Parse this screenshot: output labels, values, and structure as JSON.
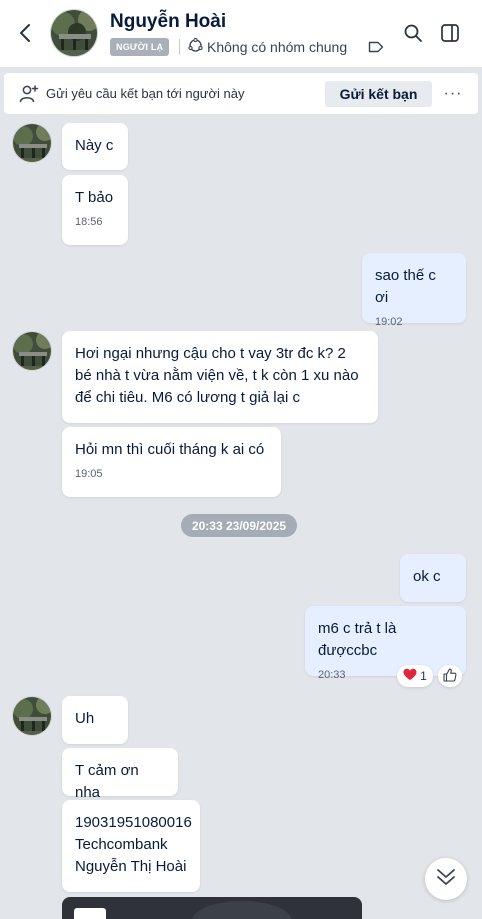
{
  "header": {
    "contact_name": "Nguyễn Hoài",
    "stranger_badge": "NGƯỜI LẠ",
    "common_groups": "Không có nhóm chung"
  },
  "friend_request": {
    "text": "Gửi yêu cầu kết bạn tới người này",
    "button": "Gửi kết bạn",
    "more": "···"
  },
  "messages": [
    {
      "from": "contact",
      "text": "Này c"
    },
    {
      "from": "contact",
      "text": "T bảo",
      "time": "18:56"
    },
    {
      "from": "me",
      "text": "sao thế c ơi",
      "time": "19:02"
    },
    {
      "from": "contact",
      "text": "Hơi ngại nhưng cậu cho t vay 3tr đc k? 2 bé nhà t vừa nằm viện về, t k còn 1 xu nào để chi tiêu. M6 có lương t giả lại c"
    },
    {
      "from": "contact",
      "text": "Hỏi mn thì cuối tháng k ai có",
      "time": "19:05"
    },
    {
      "from": "me",
      "text": "ok c"
    },
    {
      "from": "me",
      "text": "m6 c trả t là đượccbc",
      "time": "20:33",
      "reaction": {
        "emoji": "heart",
        "count": "1"
      }
    },
    {
      "from": "contact",
      "text": "Uh"
    },
    {
      "from": "contact",
      "text": "T cảm ơn nha"
    },
    {
      "from": "contact",
      "lines": [
        "19031951080016",
        "Techcombank",
        "Nguyễn Thị Hoài"
      ]
    }
  ],
  "date_separator": "20:33 23/09/2025",
  "colors": {
    "background": "#e2e5ea",
    "incoming_bubble": "#ffffff",
    "outgoing_bubble": "#e5efff",
    "text": "#081b3a",
    "heart": "#e0263a"
  },
  "icons": [
    "back-arrow-icon",
    "search-icon",
    "sidebar-toggle-icon",
    "group-icon",
    "tag-icon",
    "add-friend-icon",
    "heart-icon",
    "like-icon",
    "chevron-double-down-icon"
  ]
}
